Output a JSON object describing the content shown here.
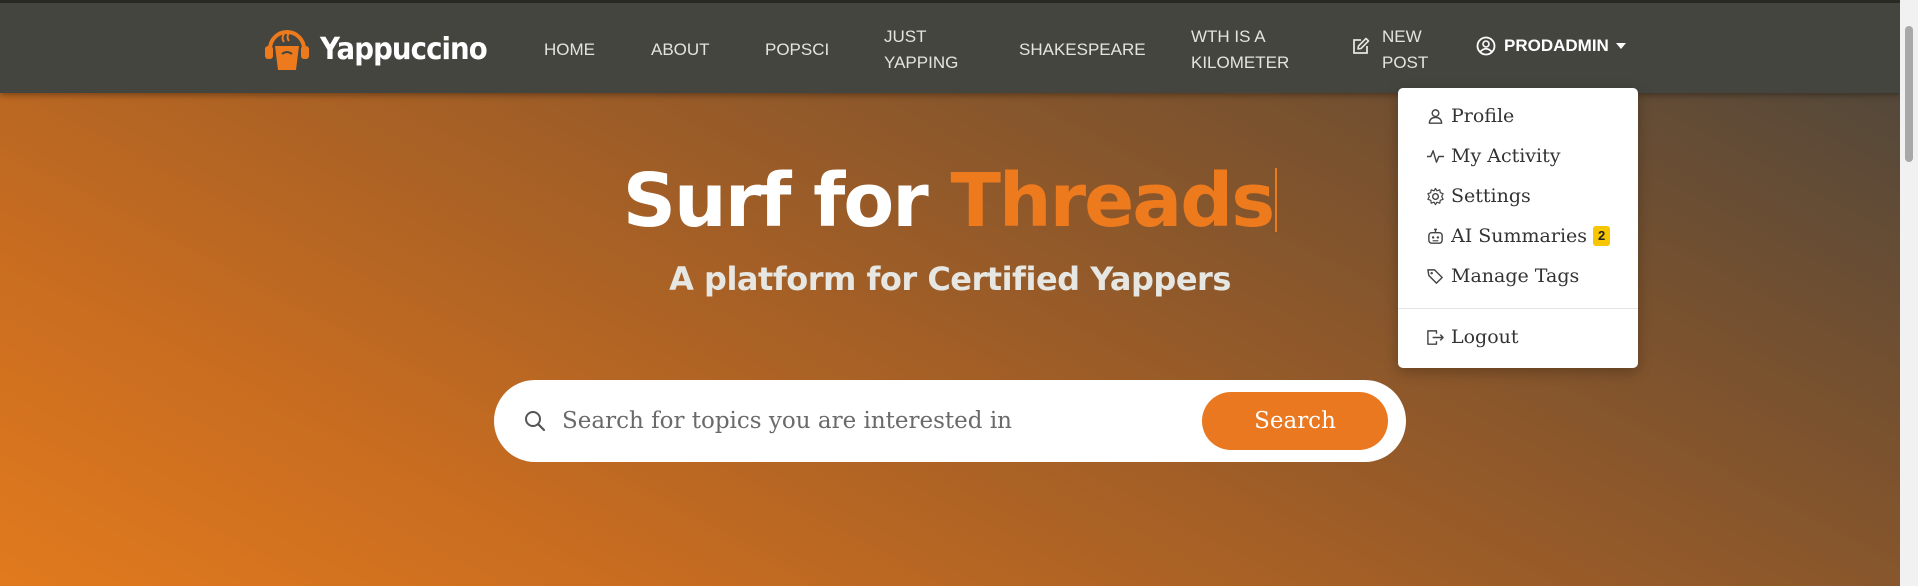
{
  "brand": {
    "name": "Yappuccino",
    "logo_icon": "coffee-cup-headphones-icon",
    "accent": "#ee7a1e"
  },
  "nav": {
    "links": [
      "HOME",
      "ABOUT",
      "POPSCI",
      "JUST YAPPING",
      "SHAKESPEARE",
      "WTH IS A KILOMETER"
    ],
    "just_yapping_line1": "JUST",
    "just_yapping_line2": "YAPPING",
    "wth_line1": "WTH IS A",
    "wth_line2": "KILOMETER",
    "new_post_line1": "NEW",
    "new_post_line2": "POST",
    "user": "PRODADMIN"
  },
  "dropdown": {
    "items": [
      {
        "label": "Profile",
        "icon": "user-icon"
      },
      {
        "label": "My Activity",
        "icon": "activity-icon"
      },
      {
        "label": "Settings",
        "icon": "gear-icon"
      },
      {
        "label": "AI Summaries",
        "icon": "robot-icon",
        "badge": "2"
      },
      {
        "label": "Manage Tags",
        "icon": "tags-icon"
      }
    ],
    "logout": {
      "label": "Logout",
      "icon": "logout-icon"
    }
  },
  "hero": {
    "headline_white": "Surf for ",
    "headline_orange": "Threads",
    "subheadline": "A platform for Certified Yappers"
  },
  "search": {
    "placeholder": "Search for topics you are interested in",
    "value": "",
    "button_label": "Search"
  },
  "colors": {
    "navbar": "#454540",
    "accent": "#ee7a1e",
    "button": "#e97820",
    "badge": "#f7c600"
  }
}
